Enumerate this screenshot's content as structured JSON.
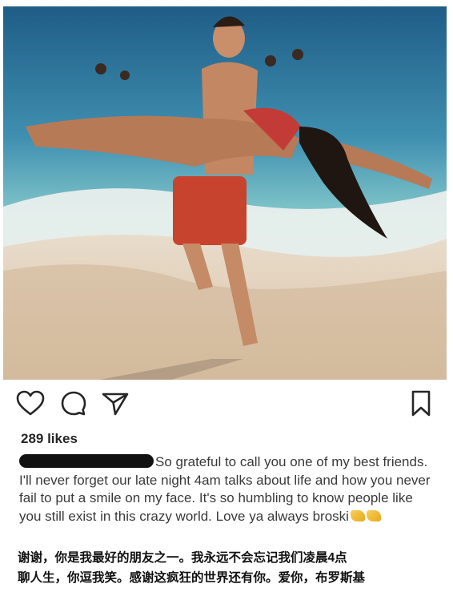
{
  "post": {
    "photo": {
      "description_icon": "photo"
    },
    "actions": {
      "like_icon": "heart-icon",
      "comment_icon": "comment-icon",
      "share_icon": "send-icon",
      "save_icon": "bookmark-icon"
    },
    "likes": "289 likes",
    "caption": {
      "text": "So grateful to call you one of my best friends. I'll never forget our late night 4am talks about life and how you never fail to put a smile on my face. It's so humbling to know people like you still exist in this crazy world. Love ya always broski"
    }
  },
  "translation": {
    "line1": "谢谢，你是我最好的朋友之一。我永远不会忘记我们凌晨4点",
    "line2": "聊人生，你逗我笑。感谢这疯狂的世界还有你。爱你，布罗斯基"
  },
  "colors": {
    "text": "#262626",
    "redaction": "#111111"
  }
}
